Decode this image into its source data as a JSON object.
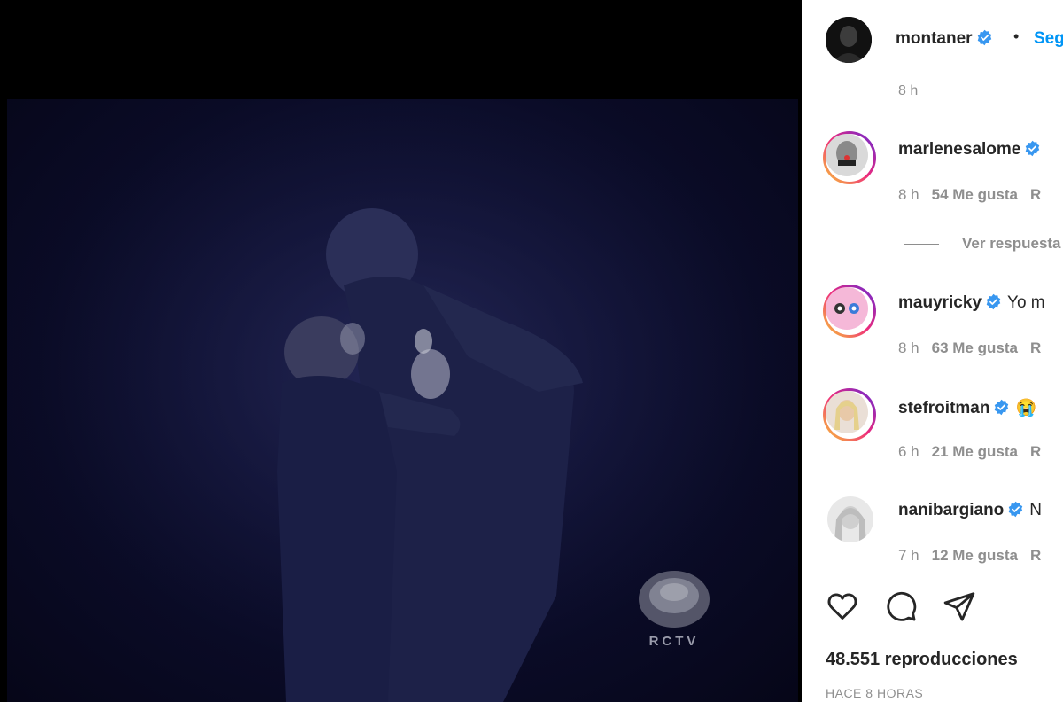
{
  "post": {
    "username": "montaner",
    "follow_label": "Seg",
    "separator": "•"
  },
  "video": {
    "watermark_text": "RCTV"
  },
  "comments": {
    "top_time": "8 h",
    "items": [
      {
        "username": "marlenesalome",
        "text": "",
        "time": "8 h",
        "likes": "54 Me gusta",
        "reply": "R",
        "story_ring": true
      },
      {
        "username": "mauyricky",
        "text": "Yo m",
        "time": "8 h",
        "likes": "63 Me gusta",
        "reply": "R",
        "story_ring": true
      },
      {
        "username": "stefroitman",
        "text": "😭",
        "time": "6 h",
        "likes": "21 Me gusta",
        "reply": "R",
        "story_ring": true
      },
      {
        "username": "nanibargiano",
        "text": "N",
        "time": "7 h",
        "likes": "12 Me gusta",
        "reply": "R",
        "story_ring": false
      }
    ],
    "view_replies": "Ver respuesta"
  },
  "actions": {
    "icons": [
      "heart-icon",
      "comment-icon",
      "share-icon"
    ]
  },
  "stats": {
    "views": "48.551 reproducciones",
    "posted": "HACE 8 HORAS"
  },
  "colors": {
    "verified": "#3897f0",
    "link": "#0095f6",
    "text": "#262626",
    "muted": "#8e8e8e"
  }
}
